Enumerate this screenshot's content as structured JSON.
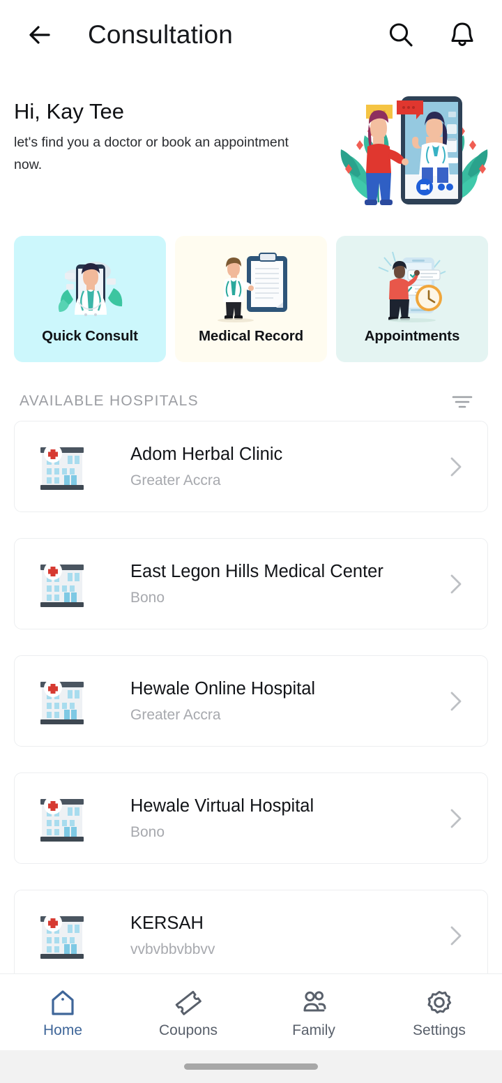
{
  "appbar": {
    "back_icon": "arrow-left-icon",
    "title": "Consultation",
    "search_icon": "search-icon",
    "notification_icon": "bell-icon"
  },
  "hero": {
    "greeting": "Hi, Kay Tee",
    "subtitle": "let's find you a doctor or book an appointment now.",
    "illustration": "telemedicine-video-call-illustration"
  },
  "feature_cards": [
    {
      "label": "Quick Consult",
      "icon": "doctor-on-phone-icon",
      "bg": "#ccf7fc"
    },
    {
      "label": "Medical Record",
      "icon": "clipboard-doctor-icon",
      "bg": "#fffcf0"
    },
    {
      "label": "Appointments",
      "icon": "calendar-clock-phone-icon",
      "bg": "#e4f4f2"
    }
  ],
  "section": {
    "title": "AVAILABLE HOSPITALS",
    "filter_icon": "filter-sort-icon"
  },
  "hospitals": [
    {
      "name": "Adom Herbal Clinic",
      "region": "Greater Accra"
    },
    {
      "name": "East Legon Hills Medical Center",
      "region": "Bono"
    },
    {
      "name": "Hewale Online Hospital",
      "region": "Greater Accra"
    },
    {
      "name": "Hewale Virtual Hospital",
      "region": "Bono"
    },
    {
      "name": "KERSAH",
      "region": "vvbvbbvbbvv"
    }
  ],
  "hospital_icon": "hospital-building-icon",
  "chevron_icon": "chevron-right-icon",
  "bottom_nav": {
    "active_color": "#3f6699",
    "inactive_color": "#59606b",
    "items": [
      {
        "label": "Home",
        "icon": "home-icon",
        "active": true
      },
      {
        "label": "Coupons",
        "icon": "ticket-icon",
        "active": false
      },
      {
        "label": "Family",
        "icon": "people-icon",
        "active": false
      },
      {
        "label": "Settings",
        "icon": "gear-icon",
        "active": false
      }
    ]
  }
}
